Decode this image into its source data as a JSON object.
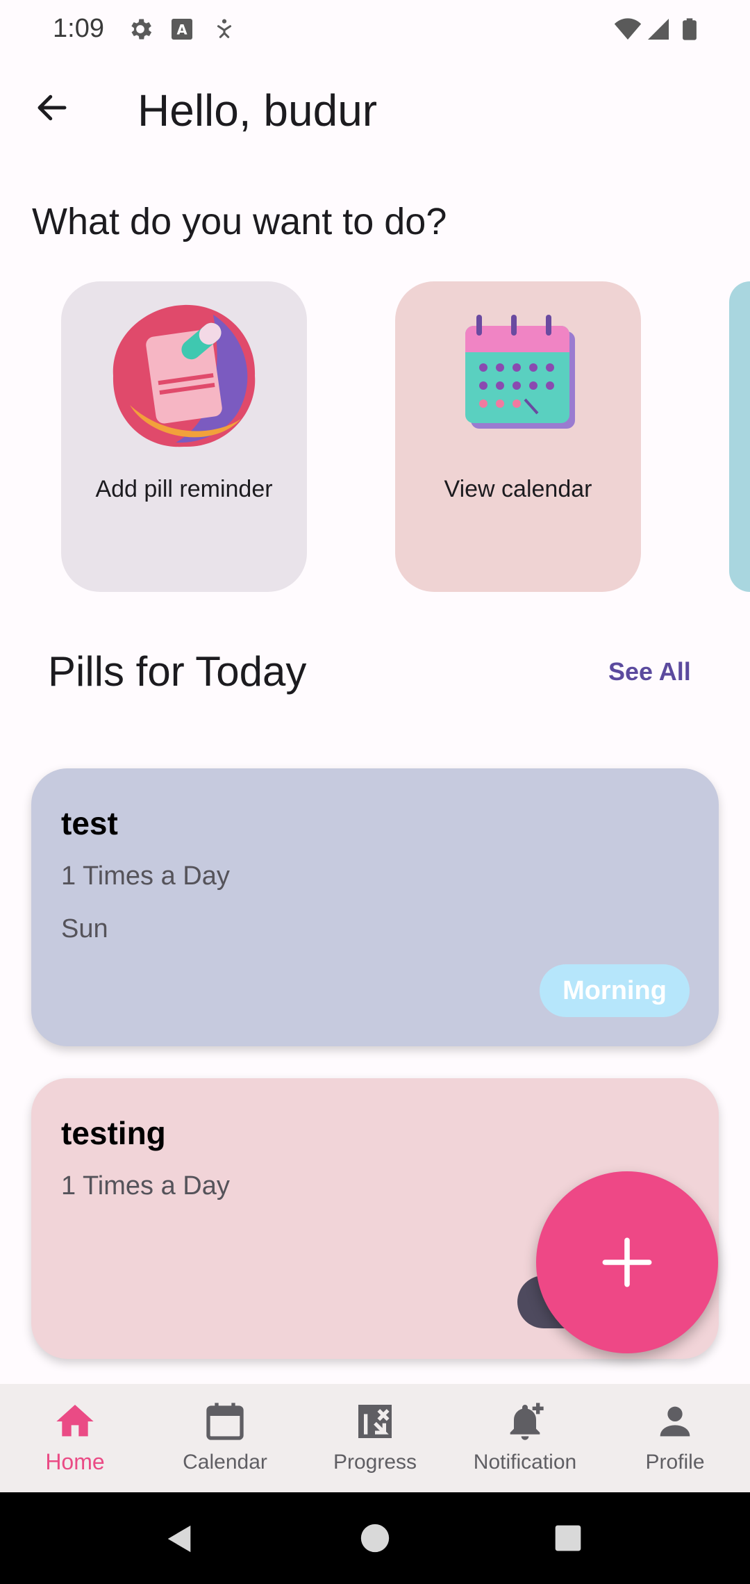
{
  "status_bar": {
    "time": "1:09"
  },
  "header": {
    "back_icon": "arrow-left-icon",
    "title": "Hello, budur"
  },
  "prompt": "What do you want to do?",
  "actions": [
    {
      "label": "Add pill reminder",
      "icon": "pill-reminder-illustration"
    },
    {
      "label": "View calendar",
      "icon": "calendar-illustration"
    }
  ],
  "pills_section": {
    "title": "Pills for Today",
    "see_all": "See All"
  },
  "pills": [
    {
      "name": "test",
      "frequency": "1 Times a Day",
      "days": "Sun",
      "time": "Morning"
    },
    {
      "name": "testing",
      "frequency": "1 Times a Day"
    }
  ],
  "fab": {
    "icon": "plus-icon"
  },
  "bottom_nav": {
    "items": [
      {
        "label": "Home",
        "icon": "home-icon",
        "active": true
      },
      {
        "label": "Calendar",
        "icon": "calendar-icon"
      },
      {
        "label": "Progress",
        "icon": "progress-icon"
      },
      {
        "label": "Notification",
        "icon": "notification-add-icon"
      },
      {
        "label": "Profile",
        "icon": "profile-icon"
      }
    ]
  },
  "colors": {
    "accent": "#ee4886",
    "link": "#5b4a9e",
    "nav_active": "#ea4b85"
  }
}
